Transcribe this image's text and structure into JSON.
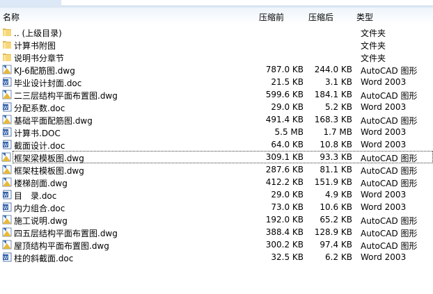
{
  "columns": {
    "name": "名称",
    "before": "压缩前",
    "after": "压缩后",
    "type": "类型"
  },
  "rows": [
    {
      "name": ".. (上级目录)",
      "before": "",
      "after": "",
      "type": "文件夹",
      "icon": "folder"
    },
    {
      "name": "计算书附图",
      "before": "",
      "after": "",
      "type": "文件夹",
      "icon": "folder"
    },
    {
      "name": "说明书分章节",
      "before": "",
      "after": "",
      "type": "文件夹",
      "icon": "folder"
    },
    {
      "name": "KJ-6配筋图.dwg",
      "before": "787.0 KB",
      "after": "244.0 KB",
      "type": "AutoCAD 图形",
      "icon": "dwg"
    },
    {
      "name": "毕业设计封面.doc",
      "before": "21.5 KB",
      "after": "3.1 KB",
      "type": "Word 2003",
      "icon": "doc"
    },
    {
      "name": "二三层结构平面布置图.dwg",
      "before": "599.6 KB",
      "after": "184.1 KB",
      "type": "AutoCAD 图形",
      "icon": "dwg"
    },
    {
      "name": "分配系数.doc",
      "before": "29.0 KB",
      "after": "5.2 KB",
      "type": "Word 2003",
      "icon": "doc"
    },
    {
      "name": "基础平面配筋图.dwg",
      "before": "491.4 KB",
      "after": "168.3 KB",
      "type": "AutoCAD 图形",
      "icon": "dwg"
    },
    {
      "name": "计算书.DOC",
      "before": "5.5 MB",
      "after": "1.7 MB",
      "type": "Word 2003",
      "icon": "doc"
    },
    {
      "name": "截面设计.doc",
      "before": "64.0 KB",
      "after": "10.8 KB",
      "type": "Word 2003",
      "icon": "doc"
    },
    {
      "name": "框架梁模板图.dwg",
      "before": "309.1 KB",
      "after": "93.3 KB",
      "type": "AutoCAD 图形",
      "icon": "dwg",
      "selected": true
    },
    {
      "name": "框架柱模板图.dwg",
      "before": "287.6 KB",
      "after": "81.1 KB",
      "type": "AutoCAD 图形",
      "icon": "dwg"
    },
    {
      "name": "楼梯剖面.dwg",
      "before": "412.2 KB",
      "after": "151.9 KB",
      "type": "AutoCAD 图形",
      "icon": "dwg"
    },
    {
      "name": "目　录.doc",
      "before": "29.0 KB",
      "after": "4.9 KB",
      "type": "Word 2003",
      "icon": "doc"
    },
    {
      "name": "内力组合.doc",
      "before": "73.0 KB",
      "after": "10.6 KB",
      "type": "Word 2003",
      "icon": "doc"
    },
    {
      "name": "施工说明.dwg",
      "before": "192.0 KB",
      "after": "65.2 KB",
      "type": "AutoCAD 图形",
      "icon": "dwg"
    },
    {
      "name": "四五层结构平面布置图.dwg",
      "before": "388.4 KB",
      "after": "128.9 KB",
      "type": "AutoCAD 图形",
      "icon": "dwg"
    },
    {
      "name": "屋顶结构平面布置图.dwg",
      "before": "300.2 KB",
      "after": "97.4 KB",
      "type": "AutoCAD 图形",
      "icon": "dwg"
    },
    {
      "name": "柱的斜截面.doc",
      "before": "32.5 KB",
      "after": "6.2 KB",
      "type": "Word 2003",
      "icon": "doc"
    }
  ]
}
